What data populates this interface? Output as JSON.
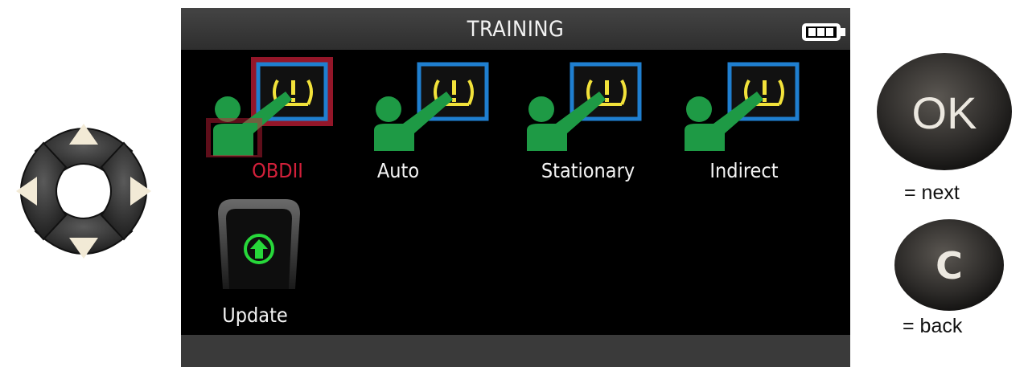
{
  "screen": {
    "title": "TRAINING",
    "battery_icon": "battery-icon"
  },
  "menu": {
    "items": [
      {
        "label": "OBDII",
        "icon": "tpms-training-icon",
        "selected": true
      },
      {
        "label": "Auto",
        "icon": "tpms-training-icon",
        "selected": false
      },
      {
        "label": "Stationary",
        "icon": "tpms-training-icon",
        "selected": false
      },
      {
        "label": "Indirect",
        "icon": "tpms-training-icon",
        "selected": false
      },
      {
        "label": "Update",
        "icon": "update-arrow-icon",
        "selected": false
      }
    ]
  },
  "controls": {
    "ok_label": "OK",
    "ok_legend": "= next",
    "c_label": "C",
    "c_legend": "= back",
    "dpad_icon": "dpad-icon"
  },
  "colors": {
    "selected_text": "#d3203a",
    "person_green": "#1e9a45",
    "board_blue": "#1f7fd0",
    "warning_yellow": "#f2e23a"
  }
}
